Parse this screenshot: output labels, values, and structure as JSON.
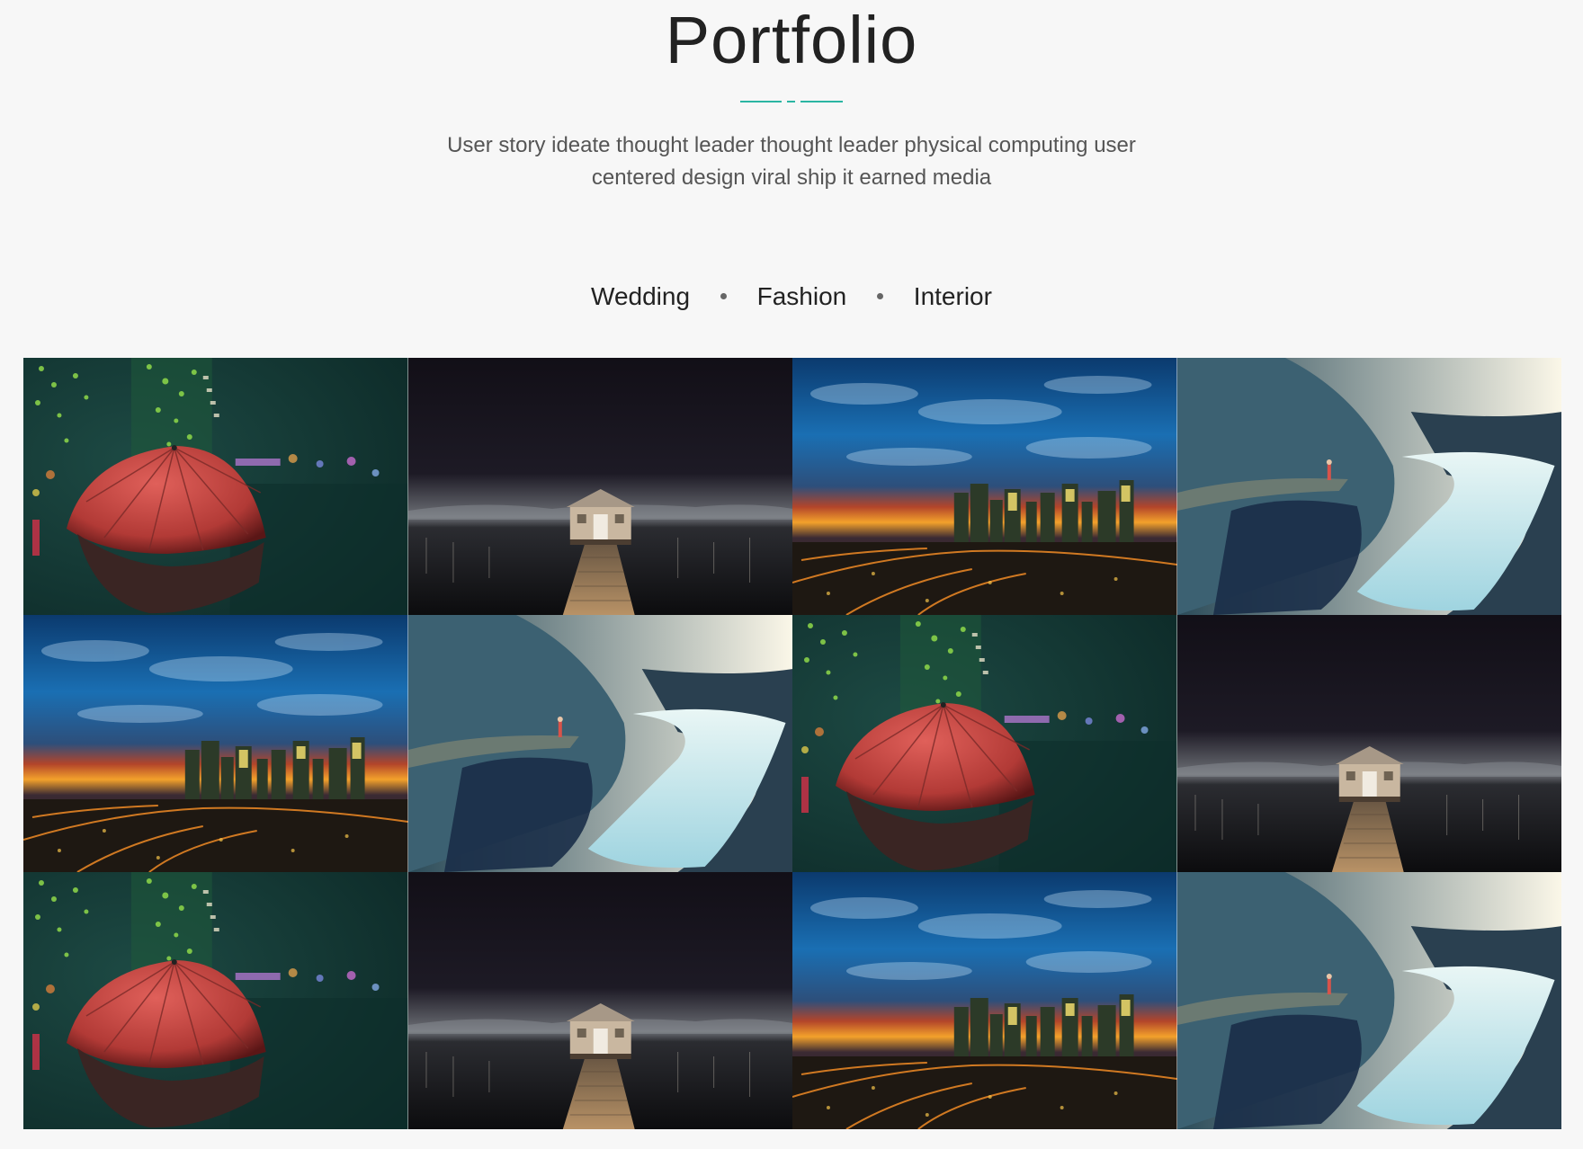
{
  "header": {
    "title": "Portfolio",
    "subtitle_line1": "User story ideate thought leader thought leader physical computing user",
    "subtitle_line2": "centered design viral ship it earned media",
    "accent_color": "#2bb5a3"
  },
  "filters": {
    "items": [
      "Wedding",
      "Fashion",
      "Interior"
    ]
  },
  "gallery": {
    "tiles": [
      {
        "scene": "umbrella-icon"
      },
      {
        "scene": "boathouse-icon"
      },
      {
        "scene": "city-sunset-icon"
      },
      {
        "scene": "fjord-cliff-icon"
      },
      {
        "scene": "city-sunset-icon"
      },
      {
        "scene": "fjord-cliff-icon"
      },
      {
        "scene": "umbrella-icon"
      },
      {
        "scene": "boathouse-icon"
      },
      {
        "scene": "umbrella-icon"
      },
      {
        "scene": "boathouse-icon"
      },
      {
        "scene": "city-sunset-icon"
      },
      {
        "scene": "fjord-cliff-icon"
      }
    ]
  }
}
